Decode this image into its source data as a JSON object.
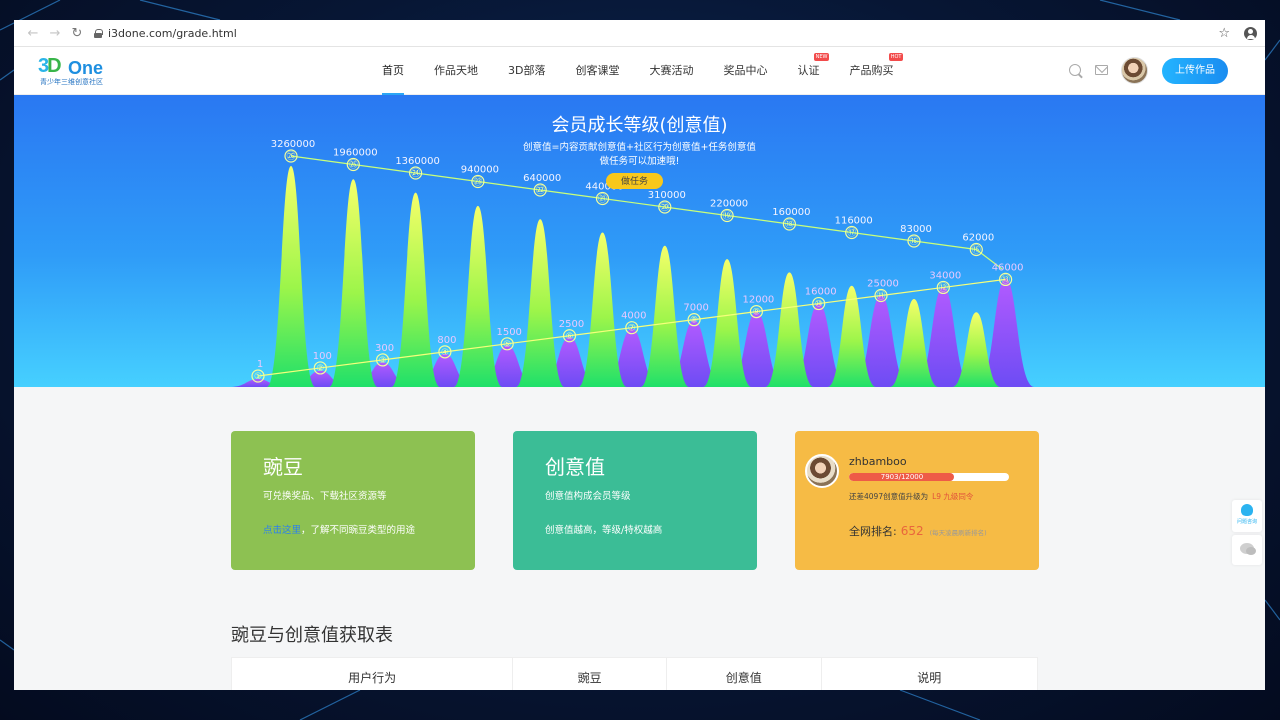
{
  "browser": {
    "url": "i3done.com/grade.html"
  },
  "site": {
    "logo_text": "One",
    "logo_sub": "青少年三维创意社区",
    "nav": [
      {
        "label": "首页",
        "badge": ""
      },
      {
        "label": "作品天地",
        "badge": ""
      },
      {
        "label": "3D部落",
        "badge": ""
      },
      {
        "label": "创客课堂",
        "badge": ""
      },
      {
        "label": "大赛活动",
        "badge": ""
      },
      {
        "label": "奖品中心",
        "badge": ""
      },
      {
        "label": "认证",
        "badge": "NEW"
      },
      {
        "label": "产品购买",
        "badge": "HOT"
      }
    ],
    "upload_label": "上传作品"
  },
  "hero": {
    "title": "会员成长等级(创意值)",
    "subtitle1": "创意值=内容贡献创意值+社区行为创意值+任务创意值",
    "subtitle2": "做任务可以加速哦!",
    "task_button": "做任务",
    "levels_low": [
      {
        "n": "①",
        "value": "1"
      },
      {
        "n": "②",
        "value": "100"
      },
      {
        "n": "③",
        "value": "300"
      },
      {
        "n": "④",
        "value": "800"
      },
      {
        "n": "⑤",
        "value": "1500"
      },
      {
        "n": "⑥",
        "value": "2500"
      },
      {
        "n": "⑦",
        "value": "4000"
      },
      {
        "n": "⑧",
        "value": "7000"
      },
      {
        "n": "⑨",
        "value": "12000"
      },
      {
        "n": "⑩",
        "value": "16000"
      },
      {
        "n": "⑪",
        "value": "25000"
      },
      {
        "n": "⑫",
        "value": "34000"
      },
      {
        "n": "⑬",
        "value": "46000"
      }
    ],
    "levels_high": [
      {
        "n": "㉖",
        "value": "3260000"
      },
      {
        "n": "㉕",
        "value": "1960000"
      },
      {
        "n": "㉔",
        "value": "1360000"
      },
      {
        "n": "㉓",
        "value": "940000"
      },
      {
        "n": "㉒",
        "value": "640000"
      },
      {
        "n": "㉑",
        "value": "440000"
      },
      {
        "n": "⑳",
        "value": "310000"
      },
      {
        "n": "⑲",
        "value": "220000"
      },
      {
        "n": "⑱",
        "value": "160000"
      },
      {
        "n": "⑰",
        "value": "116000"
      },
      {
        "n": "⑯",
        "value": "83000"
      },
      {
        "n": "⑮",
        "value": "62000"
      }
    ]
  },
  "cards": {
    "wandou": {
      "title": "豌豆",
      "line1": "可兑换奖品、下载社区资源等",
      "link": "点击这里",
      "line2_rest": "，了解不同豌豆类型的用途"
    },
    "creative": {
      "title": "创意值",
      "line1": "创意值构成会员等级",
      "line2": "创意值越高，等级/特权越高"
    },
    "user": {
      "name": "zhbamboo",
      "progress_text": "7903/12000",
      "progress": 0.6586,
      "upgrade_text": "还差4097创意值升级为",
      "upgrade_level": "L9 九级同令",
      "rank_label": "全网排名:",
      "rank_value": "652",
      "rank_note": "(每天凌晨刷新排名)"
    }
  },
  "table": {
    "title": "豌豆与创意值获取表",
    "headers": [
      "用户行为",
      "豌豆",
      "创意值",
      "说明"
    ]
  },
  "side": {
    "qa_label": "问题咨询"
  }
}
